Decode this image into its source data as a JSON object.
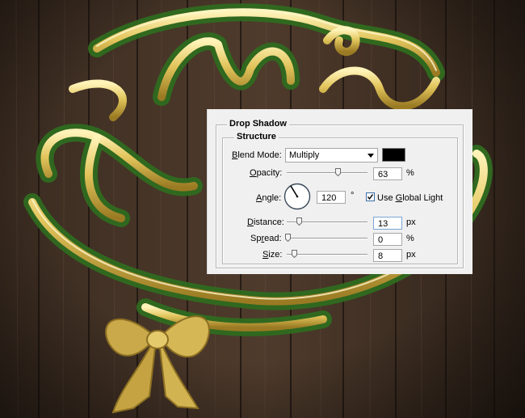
{
  "artwork": {
    "description_icon": "merry-christmas-gold-lettering",
    "colors": {
      "wood_dark": "#2e2118",
      "wood_light": "#5a4535",
      "gold": "#e8cf6a",
      "garland": "#2f6b1f"
    }
  },
  "dialog": {
    "section_title": "Drop Shadow",
    "group_title": "Structure",
    "blend_mode": {
      "label_prefix": "B",
      "label_rest": "lend Mode:",
      "value": "Multiply",
      "color_swatch": "#000000"
    },
    "opacity": {
      "label_prefix": "O",
      "label_rest": "pacity:",
      "value": "63",
      "unit": "%",
      "level": 0.63
    },
    "angle": {
      "label_prefix": "A",
      "label_rest": "ngle:",
      "value": "120",
      "unit": "°",
      "degrees": 120,
      "global_light_checked": true,
      "global_light_label_a": "Use ",
      "global_light_label_u": "G",
      "global_light_label_b": "lobal Light"
    },
    "distance": {
      "label_prefix": "D",
      "label_rest": "istance:",
      "value": "13",
      "unit": "px",
      "level": 0.13
    },
    "spread": {
      "label_a": "Sp",
      "label_u": "r",
      "label_b": "ead:",
      "value": "0",
      "unit": "%",
      "level": 0.0
    },
    "size": {
      "label_prefix": "S",
      "label_rest": "ize:",
      "value": "8",
      "unit": "px",
      "level": 0.08
    }
  }
}
